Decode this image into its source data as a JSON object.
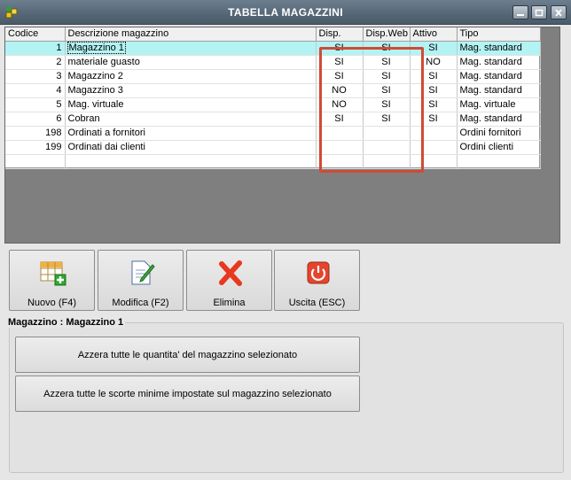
{
  "window": {
    "title": "TABELLA MAGAZZINI"
  },
  "icons": {
    "app": "app-icon",
    "minimize": "minimize-icon",
    "maximize": "maximize-icon",
    "close": "close-icon",
    "new": "new-grid-icon",
    "edit": "edit-document-icon",
    "delete": "delete-x-icon",
    "exit": "power-icon"
  },
  "colors": {
    "selected_row": "#b4f3f3",
    "highlight_box": "#cf4b35"
  },
  "table": {
    "columns": [
      "Codice",
      "Descrizione magazzino",
      "Disp.",
      "Disp.Web",
      "Attivo",
      "Tipo"
    ],
    "rows": [
      {
        "codice": "1",
        "descrizione": "Magazzino 1",
        "disp": "SI",
        "dispweb": "SI",
        "attivo": "SI",
        "tipo": "Mag. standard"
      },
      {
        "codice": "2",
        "descrizione": "materiale guasto",
        "disp": "SI",
        "dispweb": "SI",
        "attivo": "NO",
        "tipo": "Mag. standard"
      },
      {
        "codice": "3",
        "descrizione": "Magazzino 2",
        "disp": "SI",
        "dispweb": "SI",
        "attivo": "SI",
        "tipo": "Mag. standard"
      },
      {
        "codice": "4",
        "descrizione": "Magazzino 3",
        "disp": "NO",
        "dispweb": "SI",
        "attivo": "SI",
        "tipo": "Mag. standard"
      },
      {
        "codice": "5",
        "descrizione": "Mag. virtuale",
        "disp": "NO",
        "dispweb": "SI",
        "attivo": "SI",
        "tipo": "Mag. virtuale"
      },
      {
        "codice": "6",
        "descrizione": "Cobran",
        "disp": "SI",
        "dispweb": "SI",
        "attivo": "SI",
        "tipo": "Mag. standard"
      },
      {
        "codice": "198",
        "descrizione": "Ordinati a fornitori",
        "disp": "",
        "dispweb": "",
        "attivo": "",
        "tipo": "Ordini fornitori"
      },
      {
        "codice": "199",
        "descrizione": "Ordinati dai clienti",
        "disp": "",
        "dispweb": "",
        "attivo": "",
        "tipo": "Ordini clienti"
      }
    ]
  },
  "toolbar": {
    "new_label": "Nuovo (F4)",
    "edit_label": "Modifica (F2)",
    "delete_label": "Elimina",
    "exit_label": "Uscita (ESC)"
  },
  "panel": {
    "title": "Magazzino : Magazzino 1",
    "reset_qty_label": "Azzera tutte le quantita' del magazzino selezionato",
    "reset_min_label": "Azzera tutte le scorte minime impostate sul magazzino selezionato"
  }
}
